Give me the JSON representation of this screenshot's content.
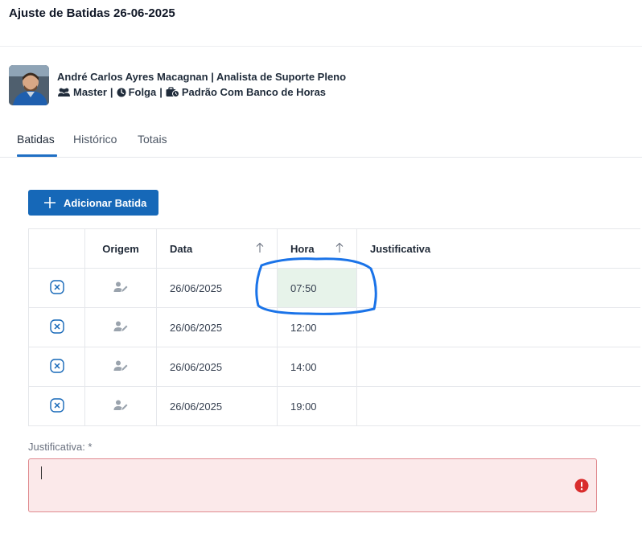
{
  "page": {
    "title": "Ajuste de Batidas 26-06-2025"
  },
  "employee": {
    "name_role": "André Carlos Ayres Macagnan | Analista de Suporte Pleno",
    "group": "Master",
    "status": "Folga",
    "schedule": "Padrão Com Banco de Horas",
    "separator": "|"
  },
  "tabs": [
    {
      "label": "Batidas",
      "active": true
    },
    {
      "label": "Histórico",
      "active": false
    },
    {
      "label": "Totais",
      "active": false
    }
  ],
  "actions": {
    "add_label": "Adicionar Batida"
  },
  "table": {
    "headers": {
      "origin": "Origem",
      "date": "Data",
      "hour": "Hora",
      "justification": "Justificativa"
    },
    "rows": [
      {
        "date": "26/06/2025",
        "hour": "07:50",
        "justification": ""
      },
      {
        "date": "26/06/2025",
        "hour": "12:00",
        "justification": ""
      },
      {
        "date": "26/06/2025",
        "hour": "14:00",
        "justification": ""
      },
      {
        "date": "26/06/2025",
        "hour": "19:00",
        "justification": ""
      }
    ]
  },
  "justification_field": {
    "label": "Justificativa: *",
    "value": ""
  },
  "colors": {
    "accent": "#1668b8",
    "error": "#d92d2d",
    "highlight_cell": "#e7f3ea",
    "annotation": "#1a73e8"
  }
}
